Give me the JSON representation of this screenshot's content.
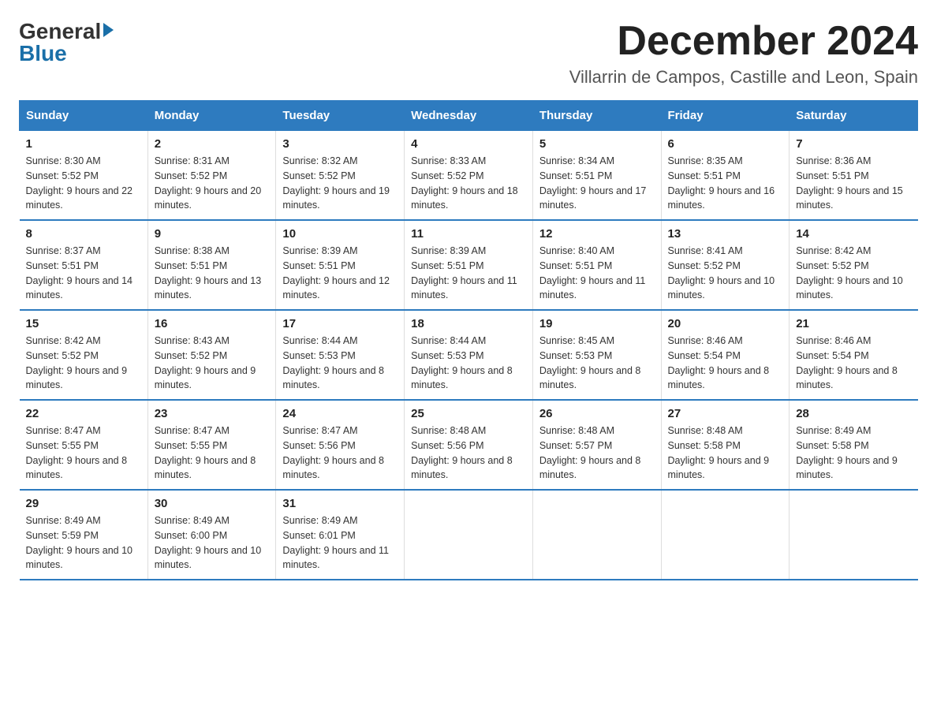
{
  "logo": {
    "general": "General",
    "blue": "Blue"
  },
  "header": {
    "title": "December 2024",
    "subtitle": "Villarrin de Campos, Castille and Leon, Spain"
  },
  "weekdays": [
    "Sunday",
    "Monday",
    "Tuesday",
    "Wednesday",
    "Thursday",
    "Friday",
    "Saturday"
  ],
  "weeks": [
    [
      {
        "day": "1",
        "sunrise": "8:30 AM",
        "sunset": "5:52 PM",
        "daylight": "9 hours and 22 minutes."
      },
      {
        "day": "2",
        "sunrise": "8:31 AM",
        "sunset": "5:52 PM",
        "daylight": "9 hours and 20 minutes."
      },
      {
        "day": "3",
        "sunrise": "8:32 AM",
        "sunset": "5:52 PM",
        "daylight": "9 hours and 19 minutes."
      },
      {
        "day": "4",
        "sunrise": "8:33 AM",
        "sunset": "5:52 PM",
        "daylight": "9 hours and 18 minutes."
      },
      {
        "day": "5",
        "sunrise": "8:34 AM",
        "sunset": "5:51 PM",
        "daylight": "9 hours and 17 minutes."
      },
      {
        "day": "6",
        "sunrise": "8:35 AM",
        "sunset": "5:51 PM",
        "daylight": "9 hours and 16 minutes."
      },
      {
        "day": "7",
        "sunrise": "8:36 AM",
        "sunset": "5:51 PM",
        "daylight": "9 hours and 15 minutes."
      }
    ],
    [
      {
        "day": "8",
        "sunrise": "8:37 AM",
        "sunset": "5:51 PM",
        "daylight": "9 hours and 14 minutes."
      },
      {
        "day": "9",
        "sunrise": "8:38 AM",
        "sunset": "5:51 PM",
        "daylight": "9 hours and 13 minutes."
      },
      {
        "day": "10",
        "sunrise": "8:39 AM",
        "sunset": "5:51 PM",
        "daylight": "9 hours and 12 minutes."
      },
      {
        "day": "11",
        "sunrise": "8:39 AM",
        "sunset": "5:51 PM",
        "daylight": "9 hours and 11 minutes."
      },
      {
        "day": "12",
        "sunrise": "8:40 AM",
        "sunset": "5:51 PM",
        "daylight": "9 hours and 11 minutes."
      },
      {
        "day": "13",
        "sunrise": "8:41 AM",
        "sunset": "5:52 PM",
        "daylight": "9 hours and 10 minutes."
      },
      {
        "day": "14",
        "sunrise": "8:42 AM",
        "sunset": "5:52 PM",
        "daylight": "9 hours and 10 minutes."
      }
    ],
    [
      {
        "day": "15",
        "sunrise": "8:42 AM",
        "sunset": "5:52 PM",
        "daylight": "9 hours and 9 minutes."
      },
      {
        "day": "16",
        "sunrise": "8:43 AM",
        "sunset": "5:52 PM",
        "daylight": "9 hours and 9 minutes."
      },
      {
        "day": "17",
        "sunrise": "8:44 AM",
        "sunset": "5:53 PM",
        "daylight": "9 hours and 8 minutes."
      },
      {
        "day": "18",
        "sunrise": "8:44 AM",
        "sunset": "5:53 PM",
        "daylight": "9 hours and 8 minutes."
      },
      {
        "day": "19",
        "sunrise": "8:45 AM",
        "sunset": "5:53 PM",
        "daylight": "9 hours and 8 minutes."
      },
      {
        "day": "20",
        "sunrise": "8:46 AM",
        "sunset": "5:54 PM",
        "daylight": "9 hours and 8 minutes."
      },
      {
        "day": "21",
        "sunrise": "8:46 AM",
        "sunset": "5:54 PM",
        "daylight": "9 hours and 8 minutes."
      }
    ],
    [
      {
        "day": "22",
        "sunrise": "8:47 AM",
        "sunset": "5:55 PM",
        "daylight": "9 hours and 8 minutes."
      },
      {
        "day": "23",
        "sunrise": "8:47 AM",
        "sunset": "5:55 PM",
        "daylight": "9 hours and 8 minutes."
      },
      {
        "day": "24",
        "sunrise": "8:47 AM",
        "sunset": "5:56 PM",
        "daylight": "9 hours and 8 minutes."
      },
      {
        "day": "25",
        "sunrise": "8:48 AM",
        "sunset": "5:56 PM",
        "daylight": "9 hours and 8 minutes."
      },
      {
        "day": "26",
        "sunrise": "8:48 AM",
        "sunset": "5:57 PM",
        "daylight": "9 hours and 8 minutes."
      },
      {
        "day": "27",
        "sunrise": "8:48 AM",
        "sunset": "5:58 PM",
        "daylight": "9 hours and 9 minutes."
      },
      {
        "day": "28",
        "sunrise": "8:49 AM",
        "sunset": "5:58 PM",
        "daylight": "9 hours and 9 minutes."
      }
    ],
    [
      {
        "day": "29",
        "sunrise": "8:49 AM",
        "sunset": "5:59 PM",
        "daylight": "9 hours and 10 minutes."
      },
      {
        "day": "30",
        "sunrise": "8:49 AM",
        "sunset": "6:00 PM",
        "daylight": "9 hours and 10 minutes."
      },
      {
        "day": "31",
        "sunrise": "8:49 AM",
        "sunset": "6:01 PM",
        "daylight": "9 hours and 11 minutes."
      },
      null,
      null,
      null,
      null
    ]
  ]
}
